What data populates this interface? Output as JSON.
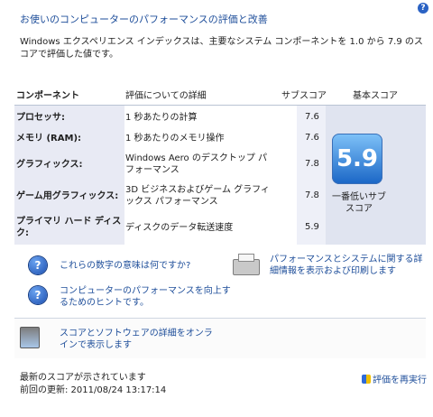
{
  "title": "お使いのコンピューターのパフォーマンスの評価と改善",
  "description": "Windows エクスペリエンス インデックスは、主要なシステム コンポーネントを 1.0 から 7.9 のスコアで評価した値です。",
  "help_icon": "?",
  "table": {
    "headers": {
      "component": "コンポーネント",
      "details": "評価についての詳細",
      "subscore": "サブスコア",
      "basescore": "基本スコア"
    },
    "rows": [
      {
        "component": "プロセッサ:",
        "details": "1 秒あたりの計算",
        "subscore": "7.6"
      },
      {
        "component": "メモリ (RAM):",
        "details": "1 秒あたりのメモリ操作",
        "subscore": "7.6"
      },
      {
        "component": "グラフィックス:",
        "details": "Windows Aero のデスクトップ パフォーマンス",
        "subscore": "7.8"
      },
      {
        "component": "ゲーム用グラフィックス:",
        "details": "3D ビジネスおよびゲーム グラフィックス パフォーマンス",
        "subscore": "7.8"
      },
      {
        "component": "プライマリ ハード ディスク:",
        "details": "ディスクのデータ転送速度",
        "subscore": "5.9"
      }
    ],
    "base_score": "5.9",
    "base_caption": "一番低いサブスコア"
  },
  "links": {
    "meaning": "これらの数字の意味は何ですか?",
    "tips": "コンピューターのパフォーマンスを向上するためのヒントです。",
    "print": "パフォーマンスとシステムに関する詳細情報を表示および印刷します",
    "online": "スコアとソフトウェアの詳細をオンラインで表示します"
  },
  "status": {
    "line1": "最新のスコアが示されています",
    "line2": "前回の更新: 2011/08/24 13:17:14"
  },
  "rerun_label": "評価を再実行",
  "icons": {
    "help": "help-icon",
    "question": "question-icon",
    "printer": "printer-icon",
    "online": "online-info-icon",
    "shield": "shield-icon"
  }
}
